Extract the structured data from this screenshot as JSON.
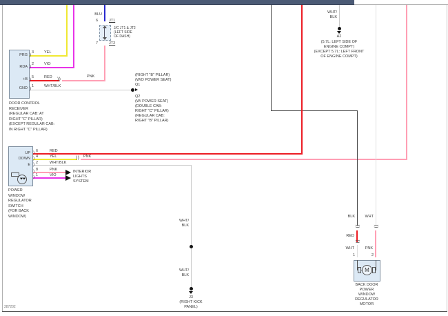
{
  "page": {
    "footer_code": "287202"
  },
  "colors": {
    "topbar": "#4b5a75",
    "topbar_edge": "#2e3a52",
    "yel": "#f0e832",
    "vio": "#e833e8",
    "blu": "#2929cf",
    "red": "#ec1c24",
    "pnk": "#ff9fb4",
    "wht_blk": "#c9c9c9",
    "wht": "#dedede",
    "blk": "#4d4d4d",
    "frame": "#b0b0b0",
    "rule": "#555555"
  },
  "symbols": {
    "connector": "))",
    "pin_bracket": ")",
    "motor_letter": "M"
  },
  "jc_junction": {
    "wire_label": "BLU",
    "top_pin": {
      "num": "6",
      "name": "JT1"
    },
    "bottom_pin": {
      "num": "7",
      "name": "JT2"
    },
    "caption": [
      "J/C JT1 & JT2",
      "(LEFT SIDE",
      "OF DASH)"
    ]
  },
  "receiver": {
    "pins": [
      {
        "name": "PRG",
        "num": "3",
        "wire": "YEL"
      },
      {
        "name": "RDA",
        "num": "2",
        "wire": "VIO"
      },
      {
        "name": "+B",
        "num": "5",
        "wire": "RED",
        "wire2": "PNK"
      },
      {
        "name": "GND",
        "num": "1",
        "wire": "WHT/BLK"
      }
    ],
    "caption": [
      "DOOR CONTROL",
      "RECEIVER",
      "(REGULAR CAB: AT",
      "RIGHT \"C\" PILLAR)",
      "(EXCEPT REGULAR CAB:",
      "IN RIGHT \"C\" PILLAR)"
    ]
  },
  "ground_q": {
    "above": [
      "(RIGHT \"B\" PILLAR)",
      "(W/O POWER SEAT)",
      "Q1"
    ],
    "below": [
      "Q2",
      "(W/ POWER SEAT)",
      "(DOUBLE CAB:",
      "RIGHT \"C\" PILLAR)",
      "(REGULAR CAB:",
      "RIGHT \"B\" PILLAR)"
    ]
  },
  "ground_a2": {
    "wire_label": [
      "WHT/",
      "BLK"
    ],
    "name": "A2",
    "caption": [
      "(5.7L: LEFT SIDE OF",
      "ENGINE COMPT)",
      "(EXCEPT 5.7L: LEFT FRONT",
      "OF ENGINE COMPT)"
    ]
  },
  "switch": {
    "pins": [
      {
        "name": "UP",
        "num": "6",
        "wire": "RED"
      },
      {
        "name": "DOWN",
        "num": "4",
        "wire": "YEL",
        "wire2": "PNK"
      },
      {
        "name": "E",
        "num": "2",
        "wire": "WHT/BLK"
      },
      {
        "name": "",
        "num": "8",
        "wire": "PNK"
      },
      {
        "name": "",
        "num": "1",
        "wire": "VIO"
      }
    ],
    "interior": [
      "INTERIOR",
      "LIGHTS",
      "SYSTEM"
    ],
    "caption": [
      "POWER",
      "WINDOW",
      "REGULATOR",
      "SWITCH",
      "(FOR BACK",
      "WINDOW)"
    ]
  },
  "kick_wire": {
    "label_upper": [
      "WHT/",
      "BLK"
    ],
    "label_lower": [
      "WHT/",
      "BLK"
    ],
    "name": "J3",
    "caption": [
      "(RIGHT KICK",
      "PANEL)"
    ]
  },
  "motor": {
    "wire_labels": {
      "blk": "BLK",
      "wht_top": "WHT",
      "red": "RED",
      "wht_bot": "WHT",
      "pnk": "PNK"
    },
    "pins": {
      "left": "1",
      "right": "2"
    },
    "caption": [
      "BACK DOOR",
      "POWER",
      "WINDOW",
      "REGULATOR",
      "MOTOR"
    ]
  }
}
